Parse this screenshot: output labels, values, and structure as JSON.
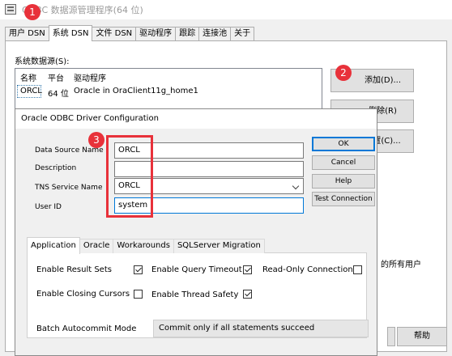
{
  "odbc": {
    "title": "ODBC 数据源管理程序(64 位)",
    "tabs": [
      "用户 DSN",
      "系统 DSN",
      "文件 DSN",
      "驱动程序",
      "跟踪",
      "连接池",
      "关于"
    ],
    "system_sources_label": "系统数据源(S):",
    "list_headers": [
      "名称",
      "平台",
      "驱动程序"
    ],
    "list_row": {
      "name": "ORCL",
      "platform": "64 位",
      "driver": "Oracle in OraClient11g_home1"
    },
    "add_button": "添加(D)...",
    "remove_button": "删除(R)",
    "configure_button": "配置(C)...",
    "description_fragment": "的所有用户",
    "help_button": "帮助"
  },
  "badges": [
    "1",
    "2",
    "3"
  ],
  "dialog": {
    "title": "Oracle ODBC Driver Configuration",
    "fields": {
      "data_source_name_label": "Data Source Name",
      "data_source_name_value": "ORCL",
      "description_label": "Description",
      "description_value": "",
      "tns_label": "TNS Service Name",
      "tns_value": "ORCL",
      "user_id_label": "User ID",
      "user_id_value": "system"
    },
    "buttons": {
      "ok": "OK",
      "cancel": "Cancel",
      "help": "Help",
      "test": "Test Connection"
    },
    "tabs": [
      "Application",
      "Oracle",
      "Workarounds",
      "SQLServer Migration"
    ],
    "options": {
      "enable_result_sets": "Enable Result Sets",
      "enable_query_timeout": "Enable Query Timeout",
      "read_only_connection": "Read-Only Connection",
      "enable_closing_cursors": "Enable Closing Cursors",
      "enable_thread_safety": "Enable Thread Safety"
    },
    "batch_label": "Batch Autocommit Mode",
    "batch_value": "Commit only if all statements succeed"
  },
  "colors": {
    "badge": "#e8313a",
    "focus_border": "#0078d7"
  }
}
